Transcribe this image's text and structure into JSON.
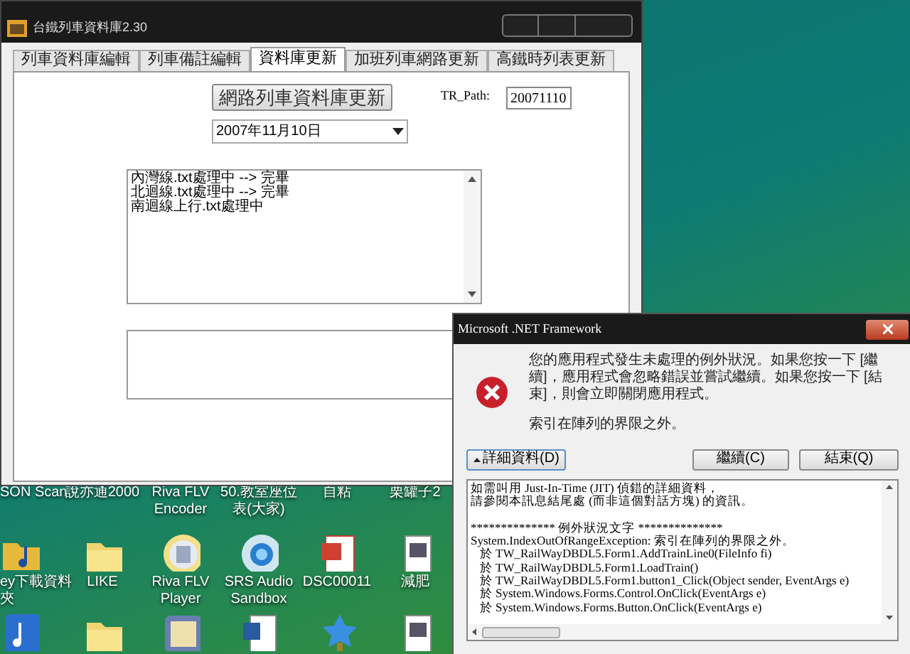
{
  "main_window": {
    "title": "台鐵列車資料庫2.30",
    "tabs": [
      {
        "label": "列車資料庫編輯",
        "selected": false
      },
      {
        "label": "列車備註編輯",
        "selected": false
      },
      {
        "label": "資料庫更新",
        "selected": true
      },
      {
        "label": "加班列車網路更新",
        "selected": false
      },
      {
        "label": "高鐵時列表更新",
        "selected": false
      }
    ],
    "update_button": "網路列車資料庫更新",
    "tr_path": {
      "label": "TR_Path:",
      "value": "20071110"
    },
    "date_dropdown": {
      "value": "2007年11月10日"
    },
    "log_lines": [
      "內灣線.txt處理中 --> 完畢",
      "北迴線.txt處理中 --> 完畢",
      "南迴線上行.txt處理中"
    ]
  },
  "error_dialog": {
    "title": "Microsoft .NET Framework",
    "message": "您的應用程式發生未處理的例外狀況。如果您按一下 [繼續]，應用程式會忽略錯誤並嘗試繼續。如果您按一下 [結束]，則會立即關閉應用程式。",
    "error": "索引在陣列的界限之外。",
    "details_button": "詳細資料(D)",
    "continue_button": "繼續(C)",
    "quit_button": "結束(Q)",
    "details_intro": [
      "如需叫用 Just-In-Time (JIT) 偵錯的詳細資料，",
      "請參閱本訊息結尾處 (而非這個對話方塊) 的資訊。"
    ],
    "details_lines": [
      "************** 例外狀況文字 **************",
      "System.IndexOutOfRangeException: 索引在陣列的界限之外。",
      "   於 TW_RailWayDBDL5.Form1.AddTrainLine0(FileInfo fi)",
      "   於 TW_RailWayDBDL5.Form1.LoadTrain()",
      "   於 TW_RailWayDBDL5.Form1.button1_Click(Object sender, EventArgs e)",
      "   於 System.Windows.Forms.Control.OnClick(EventArgs e)",
      "   於 System.Windows.Forms.Button.OnClick(EventArgs e)"
    ]
  },
  "desktop_icons": [
    {
      "label": "SON Scan",
      "kind": "none"
    },
    {
      "label": "說亦通2000",
      "kind": "none"
    },
    {
      "label": "Riva FLV Encoder",
      "kind": "none"
    },
    {
      "label": "50.教室座位表(大家)",
      "kind": "none"
    },
    {
      "label": "自粘",
      "kind": "none"
    },
    {
      "label": "栗罐子2",
      "kind": "none"
    },
    {
      "label": "ey下載資料夾",
      "kind": "music-folder"
    },
    {
      "label": "LIKE",
      "kind": "folder"
    },
    {
      "label": "Riva FLV Player",
      "kind": "player"
    },
    {
      "label": "SRS Audio Sandbox",
      "kind": "audio"
    },
    {
      "label": "DSC00011",
      "kind": "picture"
    },
    {
      "label": "減肥",
      "kind": "video"
    },
    {
      "kind": "music"
    },
    {
      "kind": "folder"
    },
    {
      "kind": "r-app"
    },
    {
      "kind": "document"
    },
    {
      "kind": "star"
    },
    {
      "kind": "video"
    }
  ]
}
